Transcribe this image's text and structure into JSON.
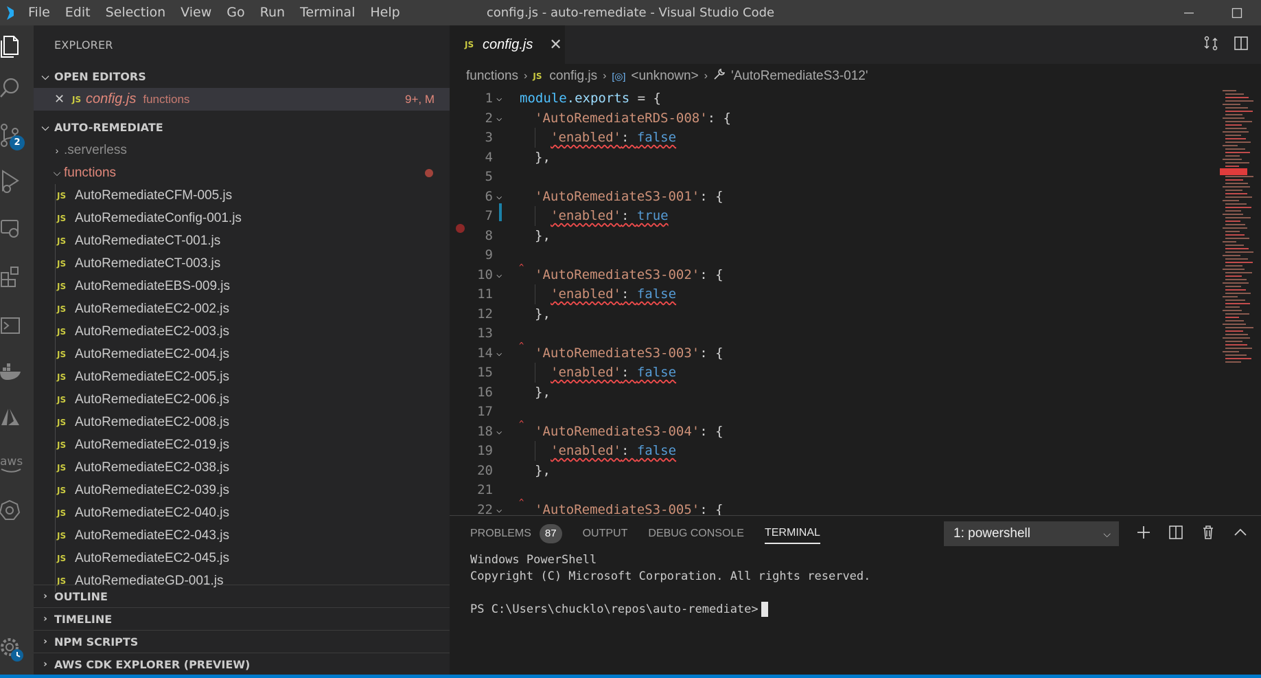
{
  "window": {
    "title": "config.js - auto-remediate - Visual Studio Code"
  },
  "menu": [
    "File",
    "Edit",
    "Selection",
    "View",
    "Go",
    "Run",
    "Terminal",
    "Help"
  ],
  "activity_bar": {
    "source_control_badge": "2"
  },
  "sidebar": {
    "title": "EXPLORER",
    "open_editors": {
      "label": "OPEN EDITORS",
      "item": {
        "icon_text": "JS",
        "name": "config.js",
        "desc": "functions",
        "status": "9+, M"
      }
    },
    "project": {
      "label": "AUTO-REMEDIATE",
      "folders": [
        ".serverless",
        "functions"
      ],
      "file_icon_text": "JS",
      "files": [
        "AutoRemediateCFM-005.js",
        "AutoRemediateConfig-001.js",
        "AutoRemediateCT-001.js",
        "AutoRemediateCT-003.js",
        "AutoRemediateEBS-009.js",
        "AutoRemediateEC2-002.js",
        "AutoRemediateEC2-003.js",
        "AutoRemediateEC2-004.js",
        "AutoRemediateEC2-005.js",
        "AutoRemediateEC2-006.js",
        "AutoRemediateEC2-008.js",
        "AutoRemediateEC2-019.js",
        "AutoRemediateEC2-038.js",
        "AutoRemediateEC2-039.js",
        "AutoRemediateEC2-040.js",
        "AutoRemediateEC2-043.js",
        "AutoRemediateEC2-045.js",
        "AutoRemediateGD-001.js"
      ]
    },
    "bottom_sections": [
      "OUTLINE",
      "TIMELINE",
      "NPM SCRIPTS",
      "AWS CDK EXPLORER (PREVIEW)"
    ]
  },
  "editor": {
    "tab": {
      "icon_text": "JS",
      "name": "config.js"
    },
    "breadcrumb": {
      "folder": "functions",
      "file_icon_text": "JS",
      "file": "config.js",
      "symbol": "<unknown>",
      "key": "'AutoRemediateS3-012'"
    },
    "line_numbers": [
      "1",
      "2",
      "3",
      "4",
      "5",
      "6",
      "7",
      "8",
      "9",
      "10",
      "11",
      "12",
      "13",
      "14",
      "15",
      "16",
      "17",
      "18",
      "19",
      "20",
      "21",
      "22"
    ],
    "code": {
      "module": "module",
      "exports": ".exports",
      "assign": " = {",
      "open_brace": ": {",
      "close_brace": "},",
      "colon": ": ",
      "enabled_key": "'enabled'",
      "blocks": [
        {
          "key": "'AutoRemediateRDS-008'",
          "value": "false"
        },
        {
          "key": "'AutoRemediateS3-001'",
          "value": "true"
        },
        {
          "key": "'AutoRemediateS3-002'",
          "value": "false"
        },
        {
          "key": "'AutoRemediateS3-003'",
          "value": "false"
        },
        {
          "key": "'AutoRemediateS3-004'",
          "value": "false"
        },
        {
          "key": "'AutoRemediateS3-005'",
          "value": ""
        }
      ]
    }
  },
  "panel": {
    "tabs": [
      {
        "label": "PROBLEMS",
        "count": "87"
      },
      {
        "label": "OUTPUT"
      },
      {
        "label": "DEBUG CONSOLE"
      },
      {
        "label": "TERMINAL"
      }
    ],
    "terminal_select": "1: powershell",
    "terminal_lines": [
      "Windows PowerShell",
      "Copyright (C) Microsoft Corporation. All rights reserved.",
      "",
      "PS C:\\Users\\chucklo\\repos\\auto-remediate>"
    ]
  },
  "colors": {
    "accent": "#007acc",
    "modified": "#e2887b",
    "error": "#f14c4c",
    "string": "#ce9178",
    "keyword": "#569cd6"
  }
}
